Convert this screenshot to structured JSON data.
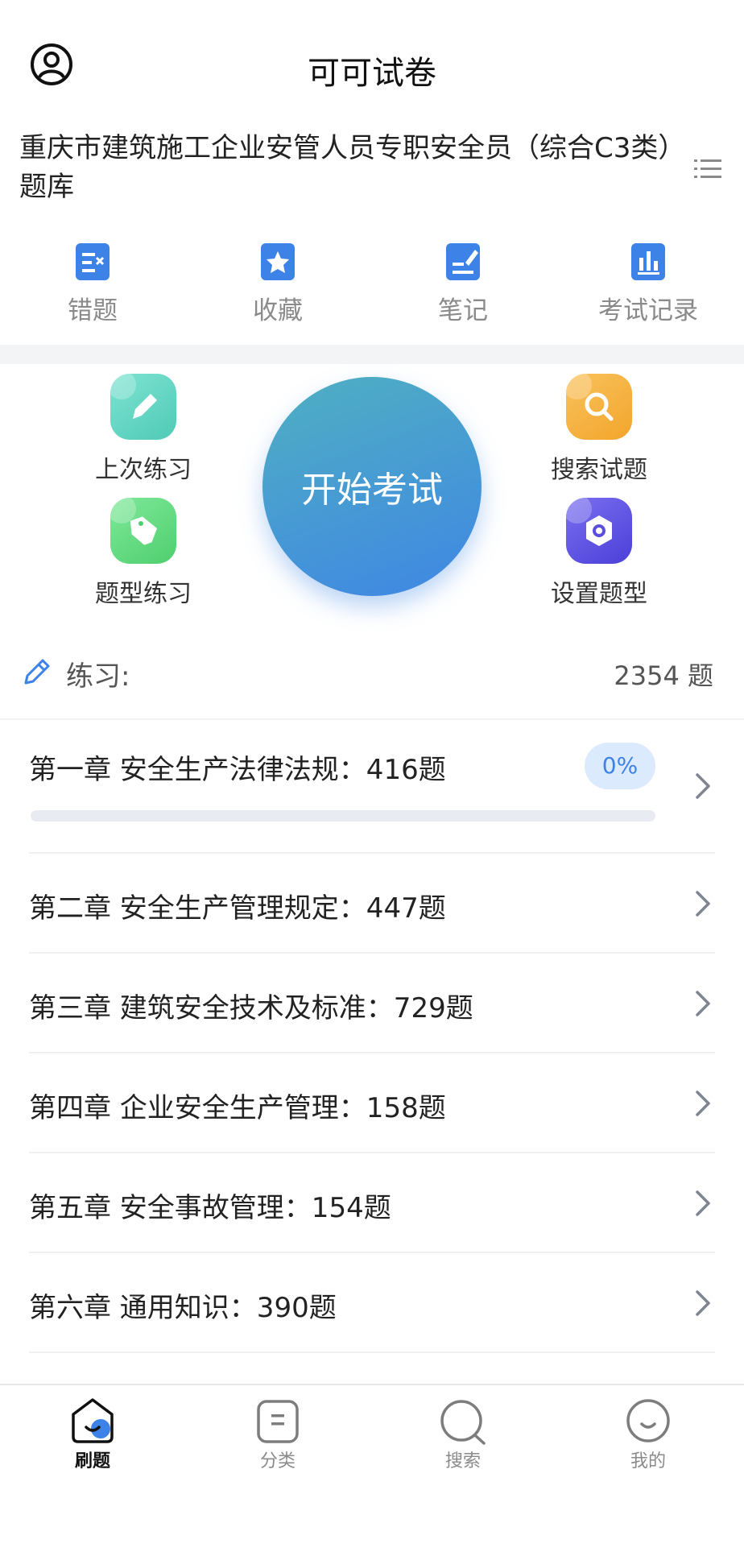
{
  "header": {
    "title": "可可试卷",
    "bank_title": "重庆市建筑施工企业安管人员专职安全员（综合C3类）题库"
  },
  "tools": [
    {
      "label": "错题",
      "icon": "wrong-questions-icon"
    },
    {
      "label": "收藏",
      "icon": "favorites-star-icon"
    },
    {
      "label": "笔记",
      "icon": "notes-edit-icon"
    },
    {
      "label": "考试记录",
      "icon": "bar-chart-icon"
    }
  ],
  "actions": {
    "last_practice": "上次练习",
    "search_questions": "搜索试题",
    "type_practice": "题型练习",
    "set_question_type": "设置题型",
    "start_exam": "开始考试"
  },
  "practice": {
    "label": "练习:",
    "count": "2354 题"
  },
  "chapters": [
    {
      "title": "第一章 安全生产法律法规：416题",
      "progress_label": "0%",
      "progress": 0
    },
    {
      "title": "第二章 安全生产管理规定：447题"
    },
    {
      "title": "第三章 建筑安全技术及标准：729题"
    },
    {
      "title": "第四章 企业安全生产管理：158题"
    },
    {
      "title": "第五章 安全事故管理：154题"
    },
    {
      "title": "第六章 通用知识：390题"
    }
  ],
  "nav": [
    {
      "label": "刷题",
      "active": true
    },
    {
      "label": "分类"
    },
    {
      "label": "搜索"
    },
    {
      "label": "我的"
    }
  ],
  "colors": {
    "accent": "#3d82e6",
    "teal": "#5fd3c1",
    "orange": "#f6b03e",
    "green": "#5fd97c",
    "purple": "#5b4fe0"
  }
}
